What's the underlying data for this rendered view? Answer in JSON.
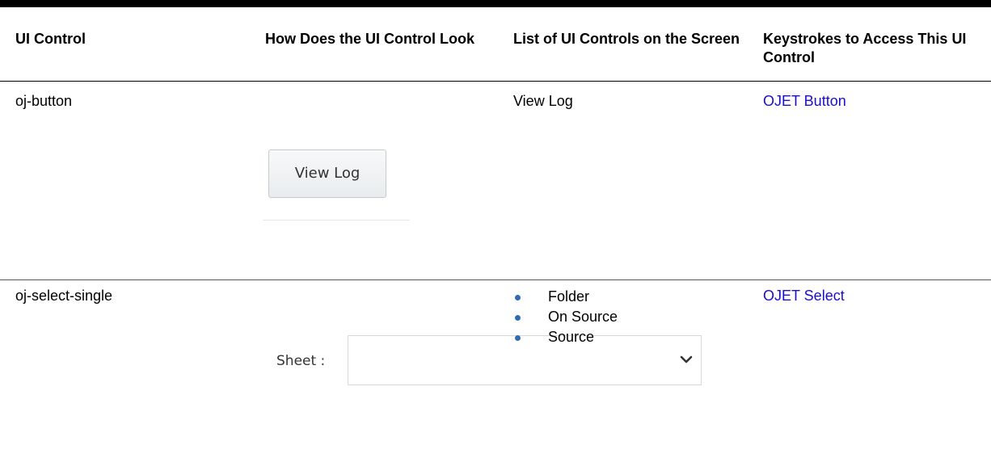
{
  "table": {
    "headers": {
      "ui_control": "UI Control",
      "look": "How Does the UI Control Look",
      "controls_list": "List of UI Controls on the Screen",
      "keystrokes": "Keystrokes to Access This UI Control"
    },
    "rows": [
      {
        "ui_control": "oj-button",
        "look": {
          "button_label": "View Log"
        },
        "controls_list": [
          "View Log"
        ],
        "keystrokes_link": "OJET Button"
      },
      {
        "ui_control": "oj-select-single",
        "look": {
          "label": "Sheet :",
          "value": ""
        },
        "controls_list": [
          "Folder",
          "On Source",
          "Source"
        ],
        "keystrokes_link": "OJET Select"
      }
    ]
  },
  "icons": {
    "dropdown": "chevron-down-icon",
    "bullet": "bullet-dot"
  },
  "colors": {
    "link": "#1a0dcc",
    "bullet": "#2e6db4",
    "header_rule": "#000000"
  }
}
